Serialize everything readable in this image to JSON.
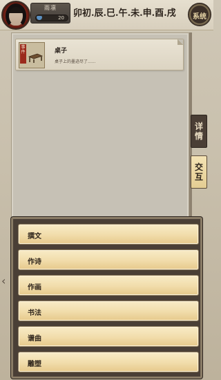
{
  "player": {
    "name": "雨凛",
    "stat_value": "20"
  },
  "time_bar": "卯初.辰.巳.午.未.申.酉.戌",
  "system_button": "系统",
  "item": {
    "name": "桌子",
    "desc": "桌子上的墨迹尽了......",
    "stamp": "事件"
  },
  "tabs": {
    "details": [
      "详",
      "情"
    ],
    "interact": [
      "交",
      "互"
    ]
  },
  "menu": [
    "撰文",
    "作诗",
    "作画",
    "书法",
    "谱曲",
    "雕塑"
  ],
  "colors": {
    "accent": "#9b2a1c",
    "button": "#f1dcaa",
    "dark_panel": "#4a3f36"
  }
}
